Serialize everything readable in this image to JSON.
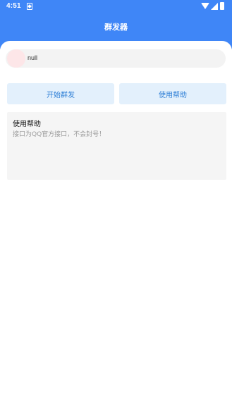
{
  "status_bar": {
    "time": "4:51",
    "left_icon": "sim-card-icon",
    "right_icons": [
      "wifi-icon",
      "signal-icon",
      "battery-icon"
    ]
  },
  "header": {
    "title": "群发器",
    "background_color": "#3f86f7"
  },
  "user": {
    "name": "null",
    "avatar_color": "#fde6e8"
  },
  "actions": {
    "start_label": "开始群发",
    "help_label": "使用帮助",
    "button_bg": "#e3f0fc",
    "button_text_color": "#2e7fd6"
  },
  "help": {
    "title": "使用帮助",
    "text": "接口为QQ官方接口，不会封号！"
  }
}
